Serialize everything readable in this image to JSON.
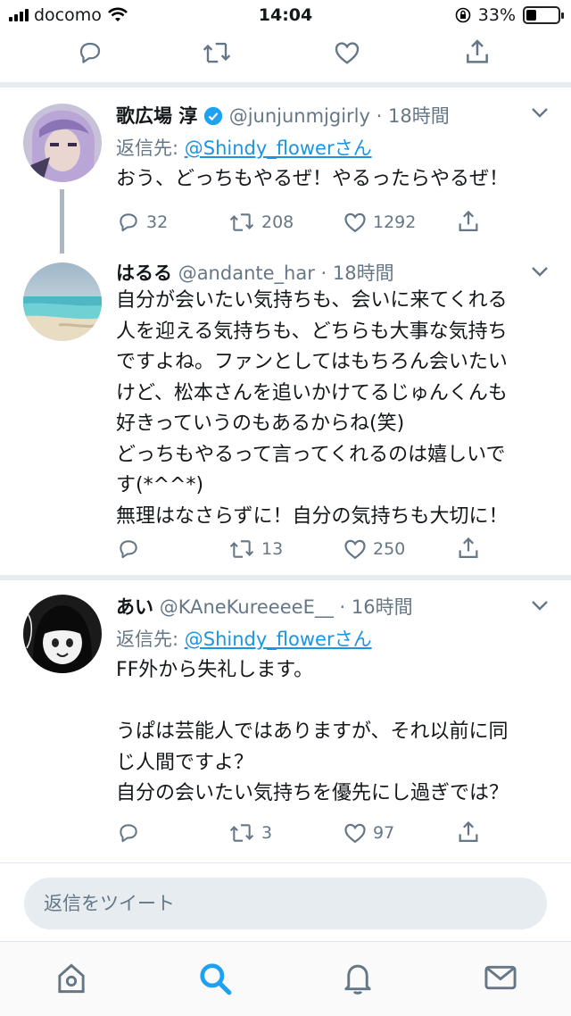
{
  "status_bar": {
    "carrier": "docomo",
    "time": "14:04",
    "battery": "33%",
    "battery_level": 0.33
  },
  "top_actions": {
    "reply": "",
    "retweet": "",
    "like": "",
    "share": ""
  },
  "tweets": [
    {
      "name": "歌広場 淳",
      "handle": "@junjunmjgirly",
      "time": "· 18時間",
      "verified": true,
      "reply_prefix": "返信先: ",
      "reply_to": "@Shindy_flowerさん",
      "text": "おう、どっちもやるぜ！やるったらやるぜ！",
      "replies": "32",
      "retweets": "208",
      "likes": "1292"
    },
    {
      "name": "はるる",
      "handle": "@andante_har",
      "time": "· 18時間",
      "verified": false,
      "text": "自分が会いたい気持ちも、会いに来てくれる\n人を迎える気持ちも、どちらも大事な気持ち\nですよね。ファンとしてはもちろん会いたい\nけど、松本さんを追いかけてるじゅんくんも\n好きっていうのもあるからね(笑)\nどっちもやるって言ってくれるのは嬉しいで\nす(*^^*)\n無理はなさらずに！自分の気持ちも大切に！",
      "replies": "",
      "retweets": "13",
      "likes": "250"
    },
    {
      "name": "あい",
      "handle": "@KAneKureeeeE__",
      "time": "· 16時間",
      "verified": false,
      "reply_prefix": "返信先: ",
      "reply_to": "@Shindy_flowerさん",
      "text": "FF外から失礼します。\n\nうぱは芸能人ではありますが、それ以前に同\nじ人間ですよ？\n自分の会いたい気持ちを優先にし過ぎでは？",
      "replies": "",
      "retweets": "3",
      "likes": "97"
    }
  ],
  "compose": {
    "placeholder": "返信をツイート"
  },
  "tabbar": {
    "items": [
      "home-icon",
      "search-icon",
      "notifications-icon",
      "messages-icon"
    ],
    "active": "search-icon"
  },
  "colors": {
    "accent": "#1da1f2",
    "link": "#1b95e0",
    "gray": "#657786"
  }
}
